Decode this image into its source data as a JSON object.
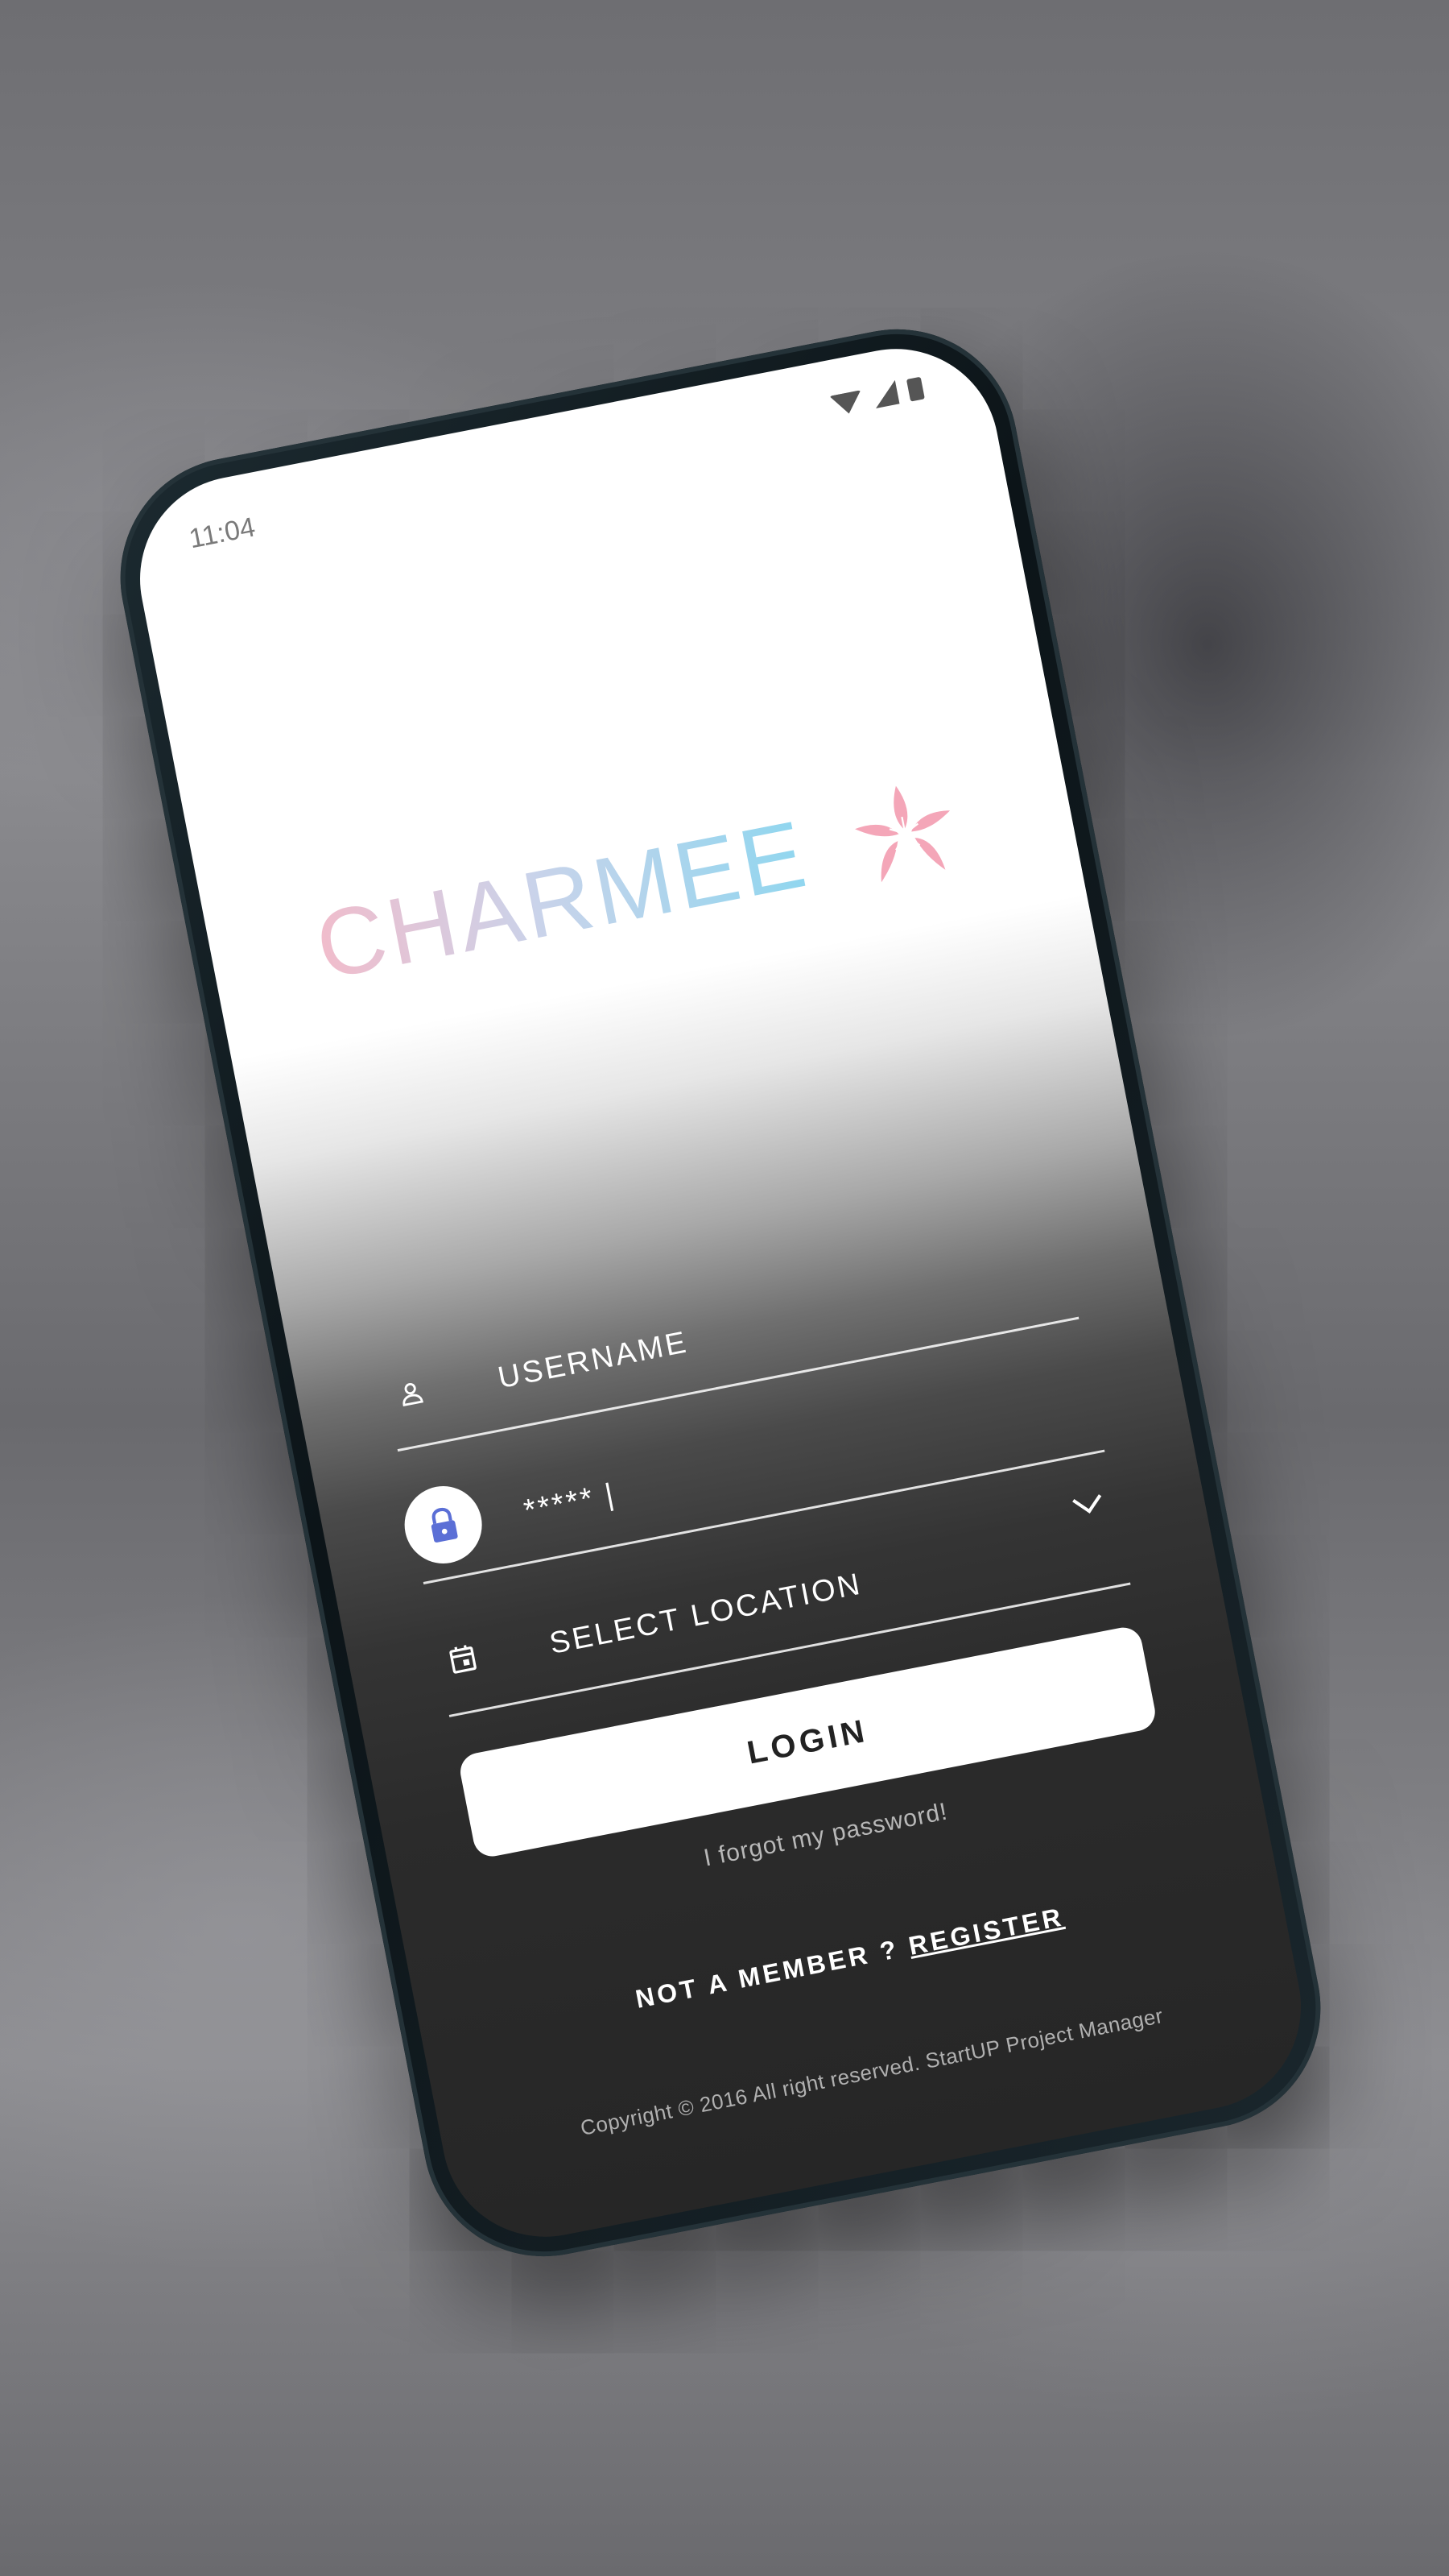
{
  "status_bar": {
    "time": "11:04",
    "icons": [
      "wifi-icon",
      "signal-icon",
      "battery-icon"
    ]
  },
  "logo": {
    "text": "CHARMEE",
    "icon": "flower-icon"
  },
  "form": {
    "username": {
      "placeholder": "USERNAME",
      "icon": "user-icon"
    },
    "password": {
      "value": "***** |",
      "icon": "lock-icon"
    },
    "location": {
      "placeholder": "SELECT LOCATION",
      "icon": "calendar-icon",
      "dropdown_icon": "chevron-down-icon"
    },
    "login_label": "LOGIN",
    "forgot_label": "I forgot my password!",
    "register_prompt": "NOT A MEMBER ? ",
    "register_label": "REGISTER"
  },
  "footer": {
    "copyright": "Copyright © 2016 All right reserved. StartUP Project Manager"
  },
  "colors": {
    "logo_pink": "#f1bccb",
    "logo_blue": "#8fd6ef",
    "lock_accent": "#5b6fd6"
  }
}
